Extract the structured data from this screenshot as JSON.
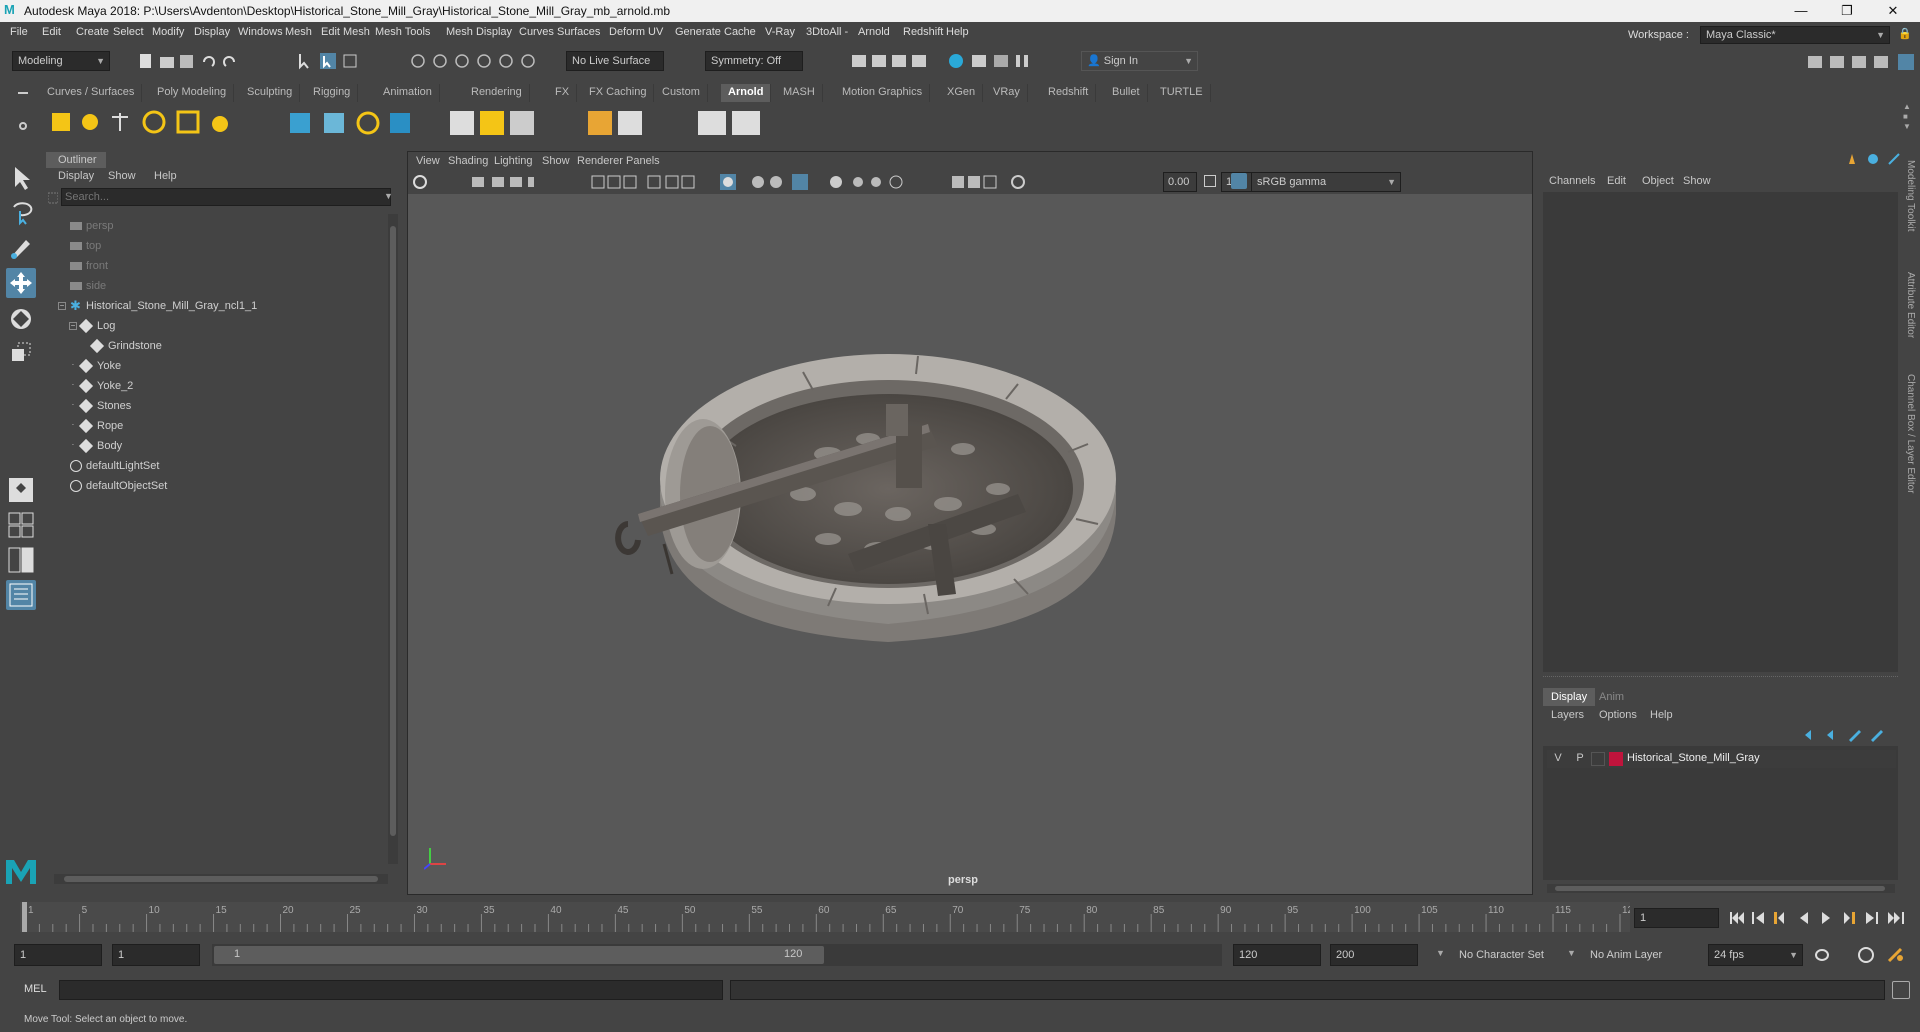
{
  "window": {
    "title": "Autodesk Maya 2018: P:\\Users\\Avdenton\\Desktop\\Historical_Stone_Mill_Gray\\Historical_Stone_Mill_Gray_mb_arnold.mb",
    "min": "—",
    "max": "❐",
    "close": "✕"
  },
  "menubar": {
    "items": [
      "File",
      "Edit",
      "Create",
      "Select",
      "Modify",
      "Display",
      "Windows",
      "Mesh",
      "Edit Mesh",
      "Mesh Tools",
      "Mesh Display",
      "Curves",
      "Surfaces",
      "Deform",
      "UV",
      "Generate",
      "Cache",
      "V-Ray",
      "3DtoAll -",
      "Arnold",
      "Redshift",
      "Help"
    ],
    "workspace_label": "Workspace :",
    "workspace_value": "Maya Classic*"
  },
  "statusline": {
    "mode": "Modeling",
    "live_surface": "No Live Surface",
    "symmetry": "Symmetry: Off",
    "sign_in": "Sign In"
  },
  "shelf": {
    "tabs": [
      "Curves / Surfaces",
      "Poly Modeling",
      "Sculpting",
      "Rigging",
      "Animation",
      "Rendering",
      "FX",
      "FX Caching",
      "Custom",
      "Arnold",
      "MASH",
      "Motion Graphics",
      "XGen",
      "VRay",
      "Redshift",
      "Bullet",
      "TURTLE"
    ],
    "active_tab": "Arnold"
  },
  "outliner": {
    "title": "Outliner",
    "menu": [
      "Display",
      "Show",
      "Help"
    ],
    "search_placeholder": "Search...",
    "items": [
      {
        "label": "persp",
        "kind": "camera",
        "depth": 0,
        "dim": true
      },
      {
        "label": "top",
        "kind": "camera",
        "depth": 0,
        "dim": true
      },
      {
        "label": "front",
        "kind": "camera",
        "depth": 0,
        "dim": true
      },
      {
        "label": "side",
        "kind": "camera",
        "depth": 0,
        "dim": true
      },
      {
        "label": "Historical_Stone_Mill_Gray_ncl1_1",
        "kind": "group",
        "depth": 0,
        "expanded": true
      },
      {
        "label": "Log",
        "kind": "mesh",
        "depth": 1,
        "expanded": true
      },
      {
        "label": "Grindstone",
        "kind": "mesh",
        "depth": 2
      },
      {
        "label": "Yoke",
        "kind": "mesh",
        "depth": 1
      },
      {
        "label": "Yoke_2",
        "kind": "mesh",
        "depth": 1
      },
      {
        "label": "Stones",
        "kind": "mesh",
        "depth": 1
      },
      {
        "label": "Rope",
        "kind": "mesh",
        "depth": 1
      },
      {
        "label": "Body",
        "kind": "mesh",
        "depth": 1
      },
      {
        "label": "defaultLightSet",
        "kind": "set",
        "depth": 0
      },
      {
        "label": "defaultObjectSet",
        "kind": "set",
        "depth": 0
      }
    ]
  },
  "viewport": {
    "menu": [
      "View",
      "Shading",
      "Lighting",
      "Show",
      "Renderer",
      "Panels"
    ],
    "field_a": "0.00",
    "field_b": "1.00",
    "colorspace": "sRGB gamma",
    "camera_label": "persp"
  },
  "channelbox": {
    "menu": [
      "Channels",
      "Edit",
      "Object",
      "Show"
    ]
  },
  "layers": {
    "tabs": [
      "Display",
      "Anim"
    ],
    "menu": [
      "Layers",
      "Options",
      "Help"
    ],
    "layer": {
      "v": "V",
      "p": "P",
      "name": "Historical_Stone_Mill_Gray",
      "color": "#c0143c"
    }
  },
  "side_tabs": [
    "Modeling Toolkit",
    "Attribute Editor",
    "Channel Box / Layer Editor"
  ],
  "timeline": {
    "ticks": [
      "1",
      "5",
      "10",
      "15",
      "20",
      "25",
      "30",
      "35",
      "40",
      "45",
      "50",
      "55",
      "60",
      "65",
      "70",
      "75",
      "80",
      "85",
      "90",
      "95",
      "100",
      "105",
      "110",
      "115",
      "120"
    ],
    "current_frame": "1"
  },
  "range": {
    "start": "1",
    "anim_start": "1",
    "slider_start": "1",
    "slider_end": "120",
    "end": "120",
    "anim_end": "200",
    "character_set": "No Character Set",
    "anim_layer": "No Anim Layer",
    "fps": "24 fps"
  },
  "cmdline": {
    "lang": "MEL"
  },
  "helpline": {
    "text": "Move Tool: Select an object to move."
  }
}
